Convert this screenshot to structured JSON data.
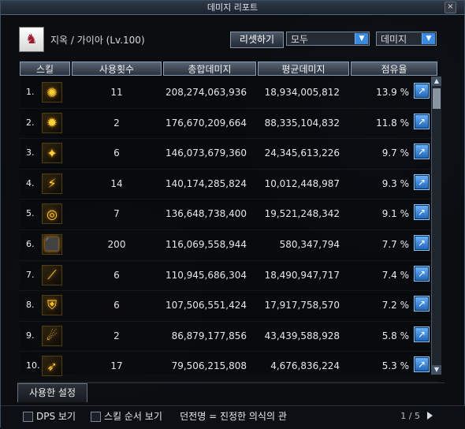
{
  "window": {
    "title": "데미지 리포트",
    "close_icon": "close-icon"
  },
  "header": {
    "player": "지옥 / 가이아 (Lv.100)",
    "reset_label": "리셋하기",
    "filter_value": "모두",
    "metric_value": "데미지"
  },
  "table": {
    "headers": [
      "스킬",
      "사용횟수",
      "총합데미지",
      "평균데미지",
      "점유율"
    ],
    "rows": [
      {
        "rank": "1.",
        "icon": "swirl-skill-icon",
        "uses": "11",
        "total": "208,274,063,936",
        "avg": "18,934,005,812",
        "share": "13.9 %"
      },
      {
        "rank": "2.",
        "icon": "fire-burst-icon",
        "uses": "2",
        "total": "176,670,209,664",
        "avg": "88,335,104,832",
        "share": "11.8 %"
      },
      {
        "rank": "3.",
        "icon": "spark-icon",
        "uses": "6",
        "total": "146,073,679,360",
        "avg": "24,345,613,226",
        "share": "9.7 %"
      },
      {
        "rank": "4.",
        "icon": "flash-icon",
        "uses": "14",
        "total": "140,174,285,824",
        "avg": "10,012,448,987",
        "share": "9.3 %"
      },
      {
        "rank": "5.",
        "icon": "vortex-icon",
        "uses": "7",
        "total": "136,648,738,400",
        "avg": "19,521,248,342",
        "share": "9.1 %"
      },
      {
        "rank": "6.",
        "icon": "shield-pulse-icon",
        "uses": "200",
        "total": "116,069,558,944",
        "avg": "580,347,794",
        "share": "7.7 %"
      },
      {
        "rank": "7.",
        "icon": "slash-icon",
        "uses": "6",
        "total": "110,945,686,304",
        "avg": "18,490,947,717",
        "share": "7.4 %"
      },
      {
        "rank": "8.",
        "icon": "shield-icon",
        "uses": "6",
        "total": "107,506,551,424",
        "avg": "17,917,758,570",
        "share": "7.2 %"
      },
      {
        "rank": "9.",
        "icon": "dragon-icon",
        "uses": "2",
        "total": "86,879,177,856",
        "avg": "43,439,588,928",
        "share": "5.8 %"
      },
      {
        "rank": "10.",
        "icon": "lance-icon",
        "uses": "17",
        "total": "79,506,215,808",
        "avg": "4,676,836,224",
        "share": "5.3 %"
      }
    ]
  },
  "tabs": {
    "active": "사용한 설정"
  },
  "footer": {
    "dps_label": "DPS 보기",
    "order_label": "스킬 순서 보기",
    "hint": "던전명 = 진정한 의식의 관",
    "page": "1 / 5"
  }
}
